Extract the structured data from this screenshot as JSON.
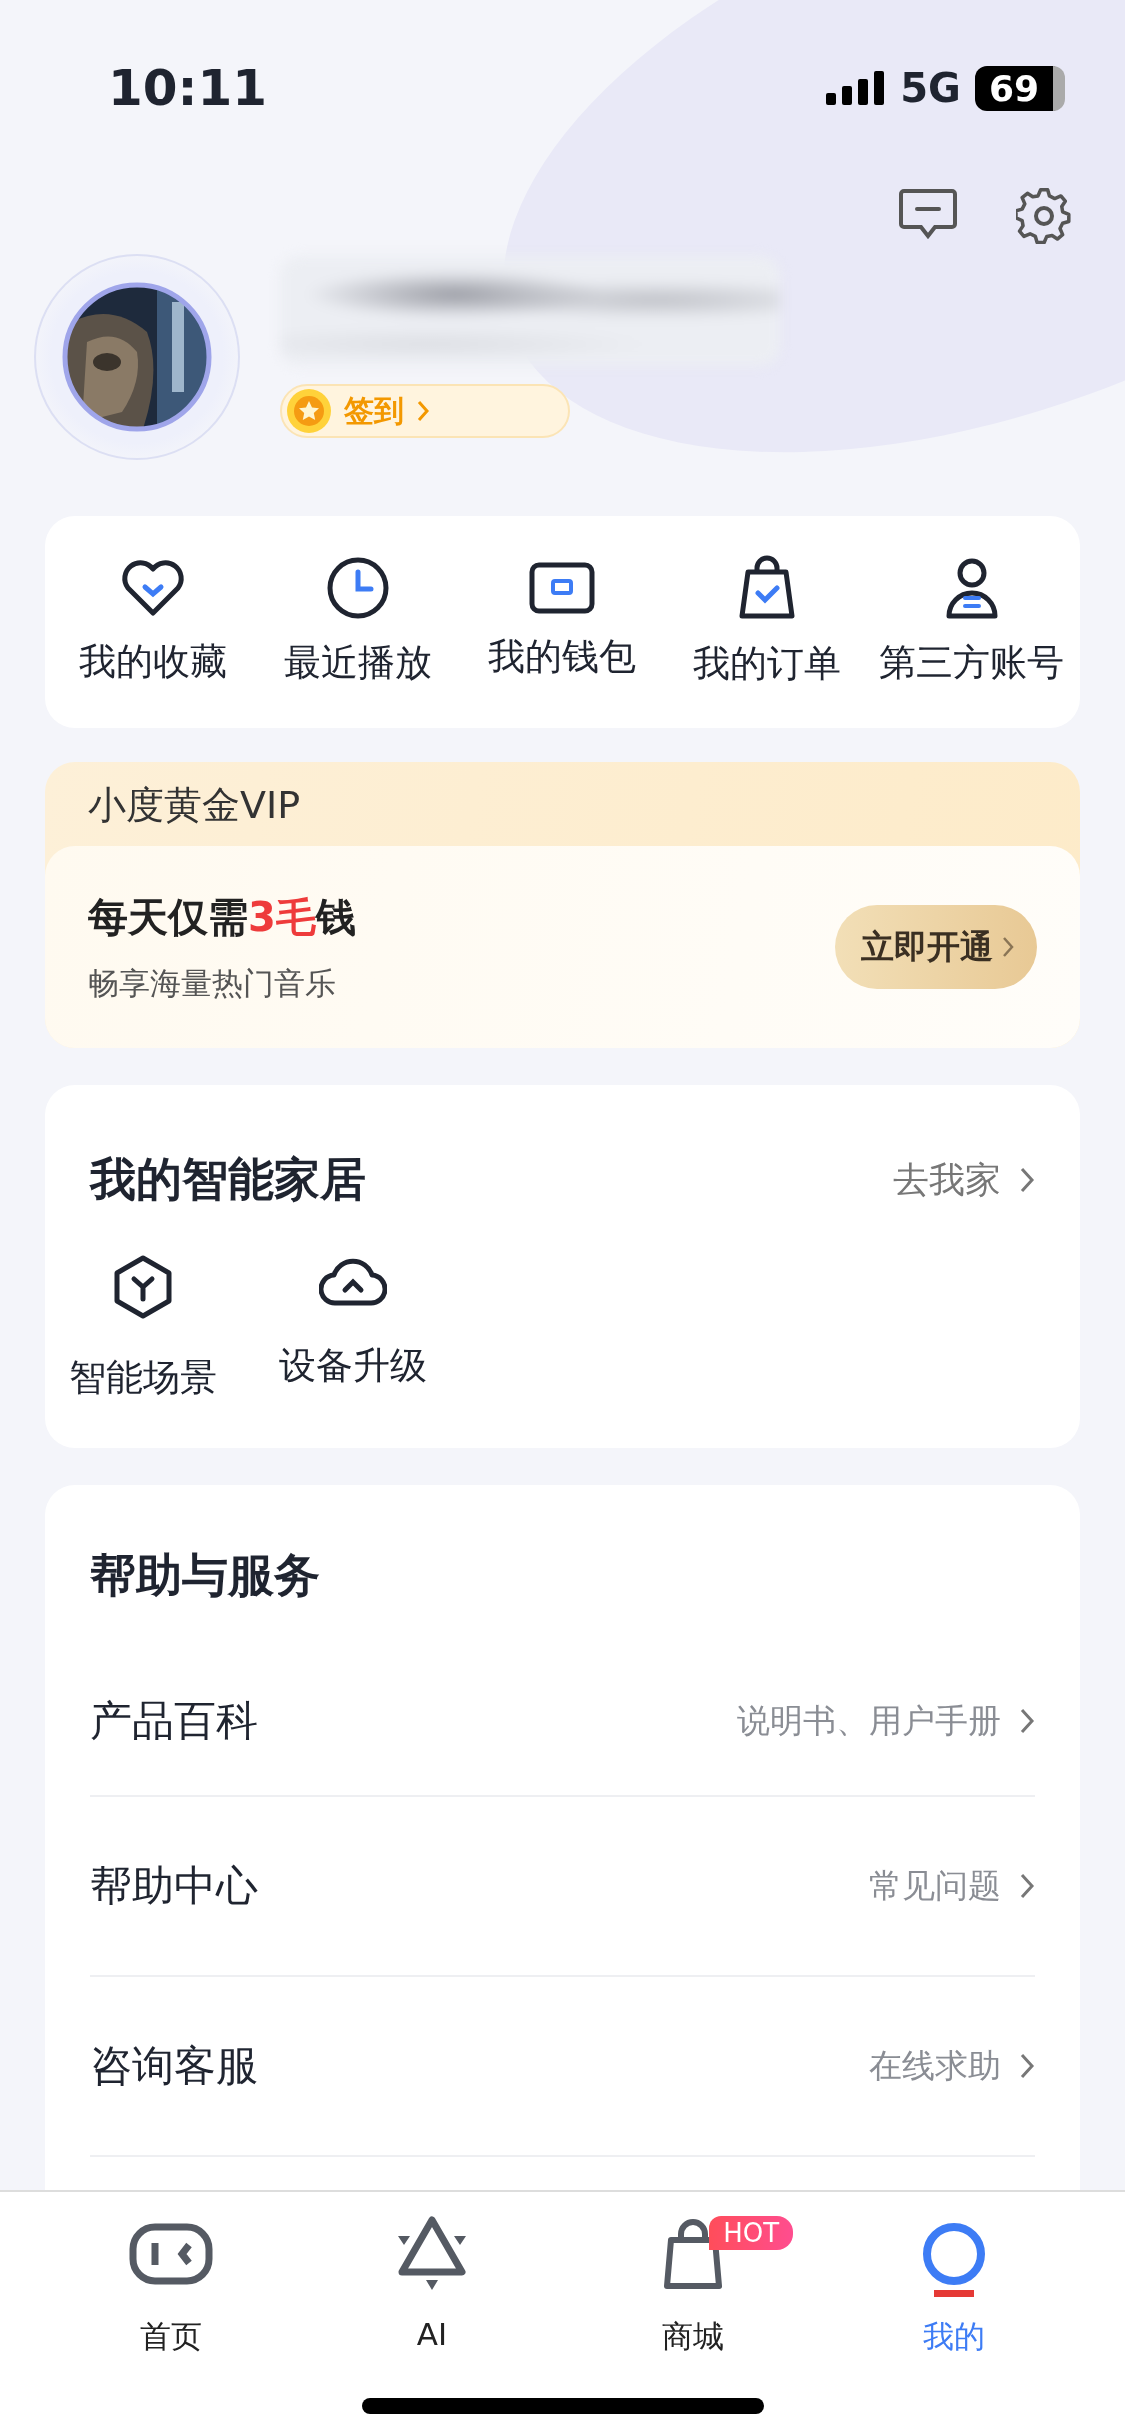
{
  "status_bar": {
    "time": "10:11",
    "network": "5G",
    "battery": "69"
  },
  "header": {
    "sign_in": "签到"
  },
  "shortcuts": [
    {
      "label": "我的收藏",
      "kind": "heart"
    },
    {
      "label": "最近播放",
      "kind": "clock"
    },
    {
      "label": "我的钱包",
      "kind": "wallet"
    },
    {
      "label": "我的订单",
      "kind": "bag"
    },
    {
      "label": "第三方账号",
      "kind": "person"
    }
  ],
  "vip": {
    "title": "小度黄金VIP",
    "headline": {
      "text": "每天仅需",
      "highlight": "3毛",
      "tail": "钱"
    },
    "subtitle": "畅享海量热门音乐",
    "button": "立即开通"
  },
  "smart_home": {
    "title": "我的智能家居",
    "link": "去我家",
    "items": [
      {
        "label": "智能场景",
        "kind": "scene"
      },
      {
        "label": "设备升级",
        "kind": "upgrade"
      }
    ]
  },
  "help": {
    "title": "帮助与服务",
    "rows": [
      {
        "label": "产品百科",
        "hint": "说明书、用户手册"
      },
      {
        "label": "帮助中心",
        "hint": "常见问题"
      },
      {
        "label": "咨询客服",
        "hint": "在线求助"
      }
    ]
  },
  "tab_bar": [
    {
      "label": "首页",
      "kind": "home",
      "selected": false
    },
    {
      "label": "AI",
      "kind": "ai",
      "selected": false
    },
    {
      "label": "商城",
      "kind": "shop",
      "selected": false,
      "badge": "HOT"
    },
    {
      "label": "我的",
      "kind": "me",
      "selected": true
    }
  ]
}
